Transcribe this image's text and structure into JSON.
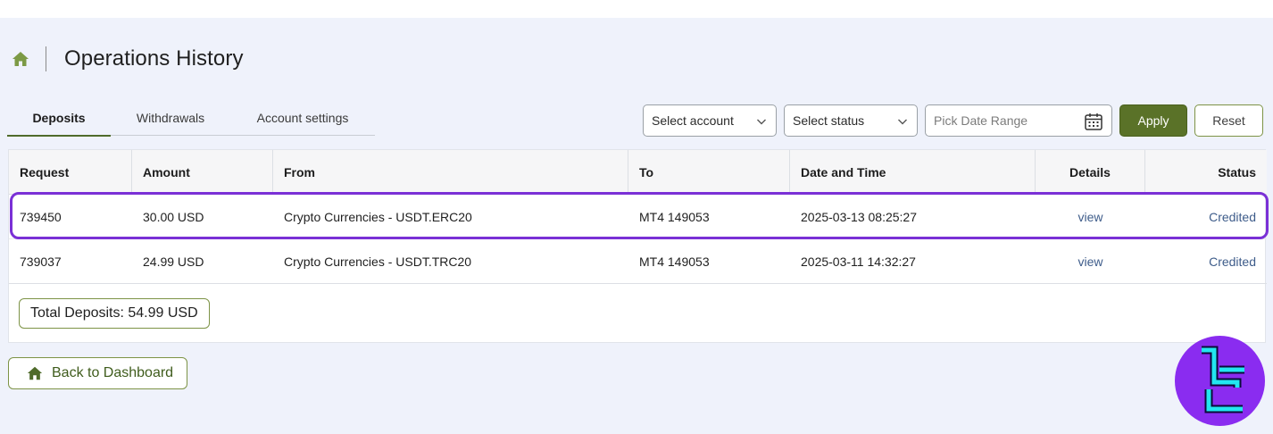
{
  "header": {
    "title": "Operations History"
  },
  "tabs": [
    {
      "label": "Deposits",
      "active": true
    },
    {
      "label": "Withdrawals",
      "active": false
    },
    {
      "label": "Account settings",
      "active": false
    }
  ],
  "filters": {
    "account_placeholder": "Select account",
    "status_placeholder": "Select status",
    "date_placeholder": "Pick Date Range",
    "apply_label": "Apply",
    "reset_label": "Reset"
  },
  "table": {
    "columns": [
      "Request",
      "Amount",
      "From",
      "To",
      "Date and Time",
      "Details",
      "Status"
    ],
    "rows": [
      {
        "request": "739450",
        "amount": "30.00 USD",
        "from": "Crypto Currencies - USDT.ERC20",
        "to": "MT4 149053",
        "datetime": "2025-03-13 08:25:27",
        "details": "view",
        "status": "Credited"
      },
      {
        "request": "739037",
        "amount": "24.99 USD",
        "from": "Crypto Currencies - USDT.TRC20",
        "to": "MT4 149053",
        "datetime": "2025-03-11 14:32:27",
        "details": "view",
        "status": "Credited"
      }
    ]
  },
  "total": "Total Deposits: 54.99 USD",
  "back_label": "Back to Dashboard",
  "colors": {
    "accent": "#5a7228",
    "highlight": "#7a30d6",
    "link": "#3e5c8a",
    "logo_bg": "#8a2cf0",
    "logo_fg": "#22e6f0"
  },
  "icons": {
    "home": "home-icon",
    "calendar": "calendar-icon",
    "chevron": "chevron-down-icon",
    "logo": "brand-logo"
  }
}
